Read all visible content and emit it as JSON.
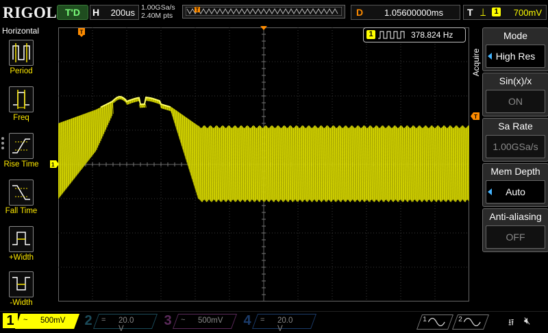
{
  "brand": "RIGOL",
  "top": {
    "trigger_status": "T'D",
    "horizontal_key": "H",
    "horizontal_scale": "200us",
    "sample_rate": "1.00GSa/s",
    "memory_points": "2.40M pts",
    "delay_key": "D",
    "delay_value": "1.05600000ms",
    "trigger_key": "T",
    "trigger_edge": "rising-edge-icon",
    "trigger_source": "1",
    "trigger_level": "700mV"
  },
  "left_panel": {
    "title": "Horizontal",
    "items": [
      {
        "label": "Period",
        "icon": "period-icon"
      },
      {
        "label": "Freq",
        "icon": "frequency-icon"
      },
      {
        "label": "Rise Time",
        "icon": "rise-time-icon"
      },
      {
        "label": "Fall Time",
        "icon": "fall-time-icon"
      },
      {
        "label": "+Width",
        "icon": "positive-width-icon"
      },
      {
        "label": "-Width",
        "icon": "negative-width-icon"
      }
    ]
  },
  "measurement": {
    "channel": "1",
    "value": "378.824 Hz"
  },
  "right_panel": {
    "tab": "Acquire",
    "mode": {
      "title": "Mode",
      "value": "High Res"
    },
    "sinx": {
      "title": "Sin(x)/x",
      "value": "ON"
    },
    "sa_rate": {
      "title": "Sa Rate",
      "value": "1.00GSa/s"
    },
    "mem_depth": {
      "title": "Mem Depth",
      "value": "Auto"
    },
    "anti_aliasing": {
      "title": "Anti-aliasing",
      "value": "OFF"
    }
  },
  "channels": [
    {
      "num": "1",
      "coupling": "~",
      "scale": "500mV"
    },
    {
      "num": "2",
      "coupling": "=",
      "scale": "20.0 V"
    },
    {
      "num": "3",
      "coupling": "~",
      "scale": "500mV"
    },
    {
      "num": "4",
      "coupling": "=",
      "scale": "20.0 V"
    }
  ],
  "generators": [
    "1",
    "2"
  ],
  "status_icons": [
    "usb-icon",
    "speaker-muted-icon"
  ],
  "colors": {
    "ch1": "#ffff00",
    "ch2": "#00c0ff",
    "ch3": "#ff00ff",
    "ch4": "#0066ff",
    "trigger_marker": "#ff8c00",
    "grid": "#3a3a3a"
  }
}
